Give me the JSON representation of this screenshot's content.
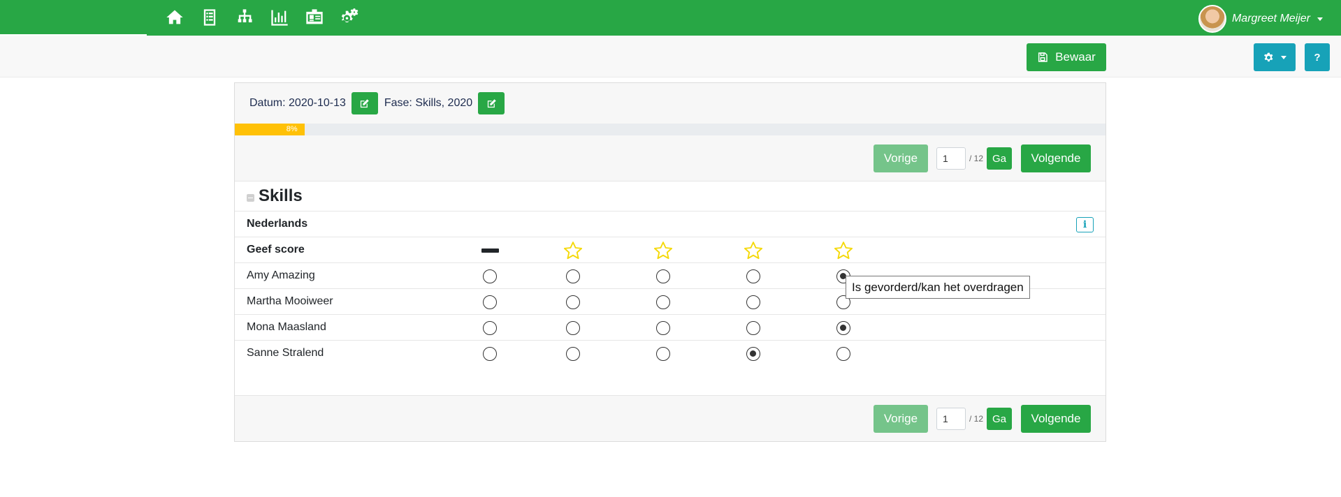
{
  "nav": {
    "icons": [
      "home-icon",
      "checklist-icon",
      "hierarchy-icon",
      "bar-chart-icon",
      "id-card-icon",
      "cogs-icon"
    ]
  },
  "user": {
    "name": "Margreet Meijer"
  },
  "toolbar": {
    "save_label": "Bewaar",
    "help_label": "?"
  },
  "header": {
    "date_text": "Datum: 2020-10-13",
    "phase_text": "Fase: Skills, 2020"
  },
  "progress": {
    "percent": 8,
    "label": "8%"
  },
  "pager": {
    "prev_label": "Vorige",
    "page_value": "1",
    "total_text": "/ 12",
    "go_label": "Ga",
    "next_label": "Volgende"
  },
  "section": {
    "title": "Skills"
  },
  "subject": {
    "name": "Nederlands",
    "info_label": "i"
  },
  "score_row": {
    "label": "Geef score"
  },
  "students": [
    {
      "name": "Amy Amazing",
      "selected": 4
    },
    {
      "name": "Martha Mooiweer",
      "selected": -1
    },
    {
      "name": "Mona Maasland",
      "selected": 4
    },
    {
      "name": "Sanne Stralend",
      "selected": 3
    }
  ],
  "tooltip": {
    "text": "Is gevorderd/kan het overdragen"
  },
  "colors": {
    "primary_green": "#28a745",
    "accent_cyan": "#17a2b8",
    "progress_yellow": "#ffc107",
    "star_yellow": "#f5d90a"
  }
}
